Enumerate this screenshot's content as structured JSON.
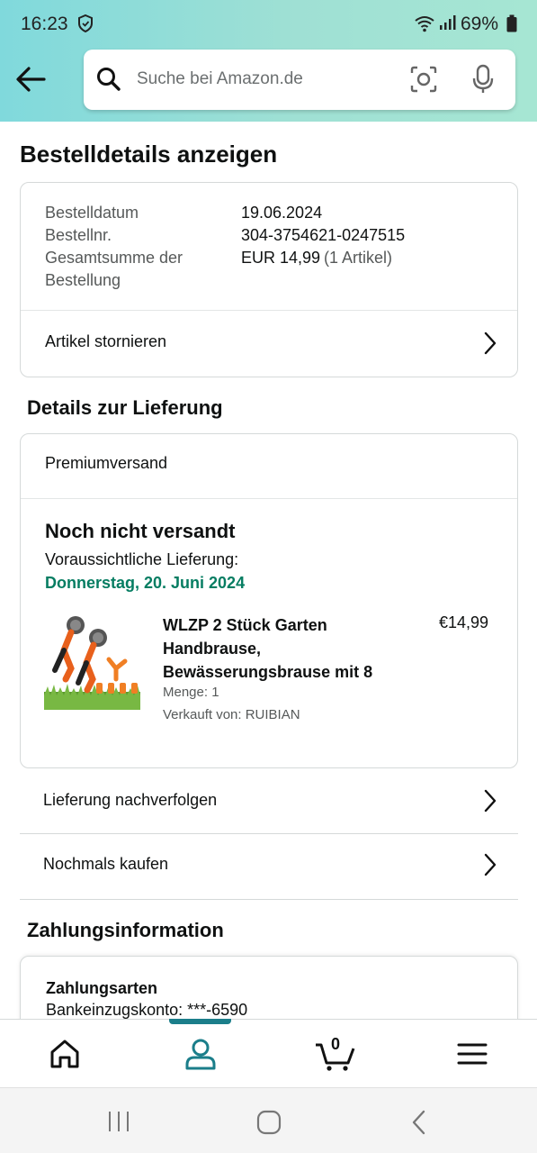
{
  "status_bar": {
    "time": "16:23",
    "battery": "69%"
  },
  "search": {
    "placeholder": "Suche bei Amazon.de"
  },
  "page_title": "Bestelldetails anzeigen",
  "order": {
    "date_label": "Bestelldatum",
    "date_value": "19.06.2024",
    "number_label": "Bestellnr.",
    "number_value": "304-3754621-0247515",
    "total_label_1": "Gesamtsumme der",
    "total_label_2": "Bestellung",
    "total_value": "EUR 14,99",
    "total_items": "(1 Artikel)",
    "cancel_label": "Artikel stornieren"
  },
  "delivery": {
    "section_title": "Details zur Lieferung",
    "shipping_method": "Premiumversand",
    "status": "Noch nicht versandt",
    "eta_label": "Voraussichtliche Lieferung:",
    "eta_date": "Donnerstag, 20. Juni 2024",
    "product": {
      "title": "WLZP 2 Stück Garten Handbrause, Bewässerungsbrause mit 8",
      "price": "€14,99",
      "quantity": "Menge: 1",
      "seller": "Verkauft von: RUIBIAN"
    },
    "track_label": "Lieferung nachverfolgen",
    "buy_again_label": "Nochmals kaufen"
  },
  "payment": {
    "section_title": "Zahlungsinformation",
    "methods_title": "Zahlungsarten",
    "method_line": "Bankeinzugskonto: ***-6590"
  },
  "tabbar": {
    "cart_count": "0",
    "active_tab": "account"
  },
  "colors": {
    "accent": "#1b7e8a",
    "delivery_green": "#067d62",
    "header_gradient": "#80d9dc"
  }
}
